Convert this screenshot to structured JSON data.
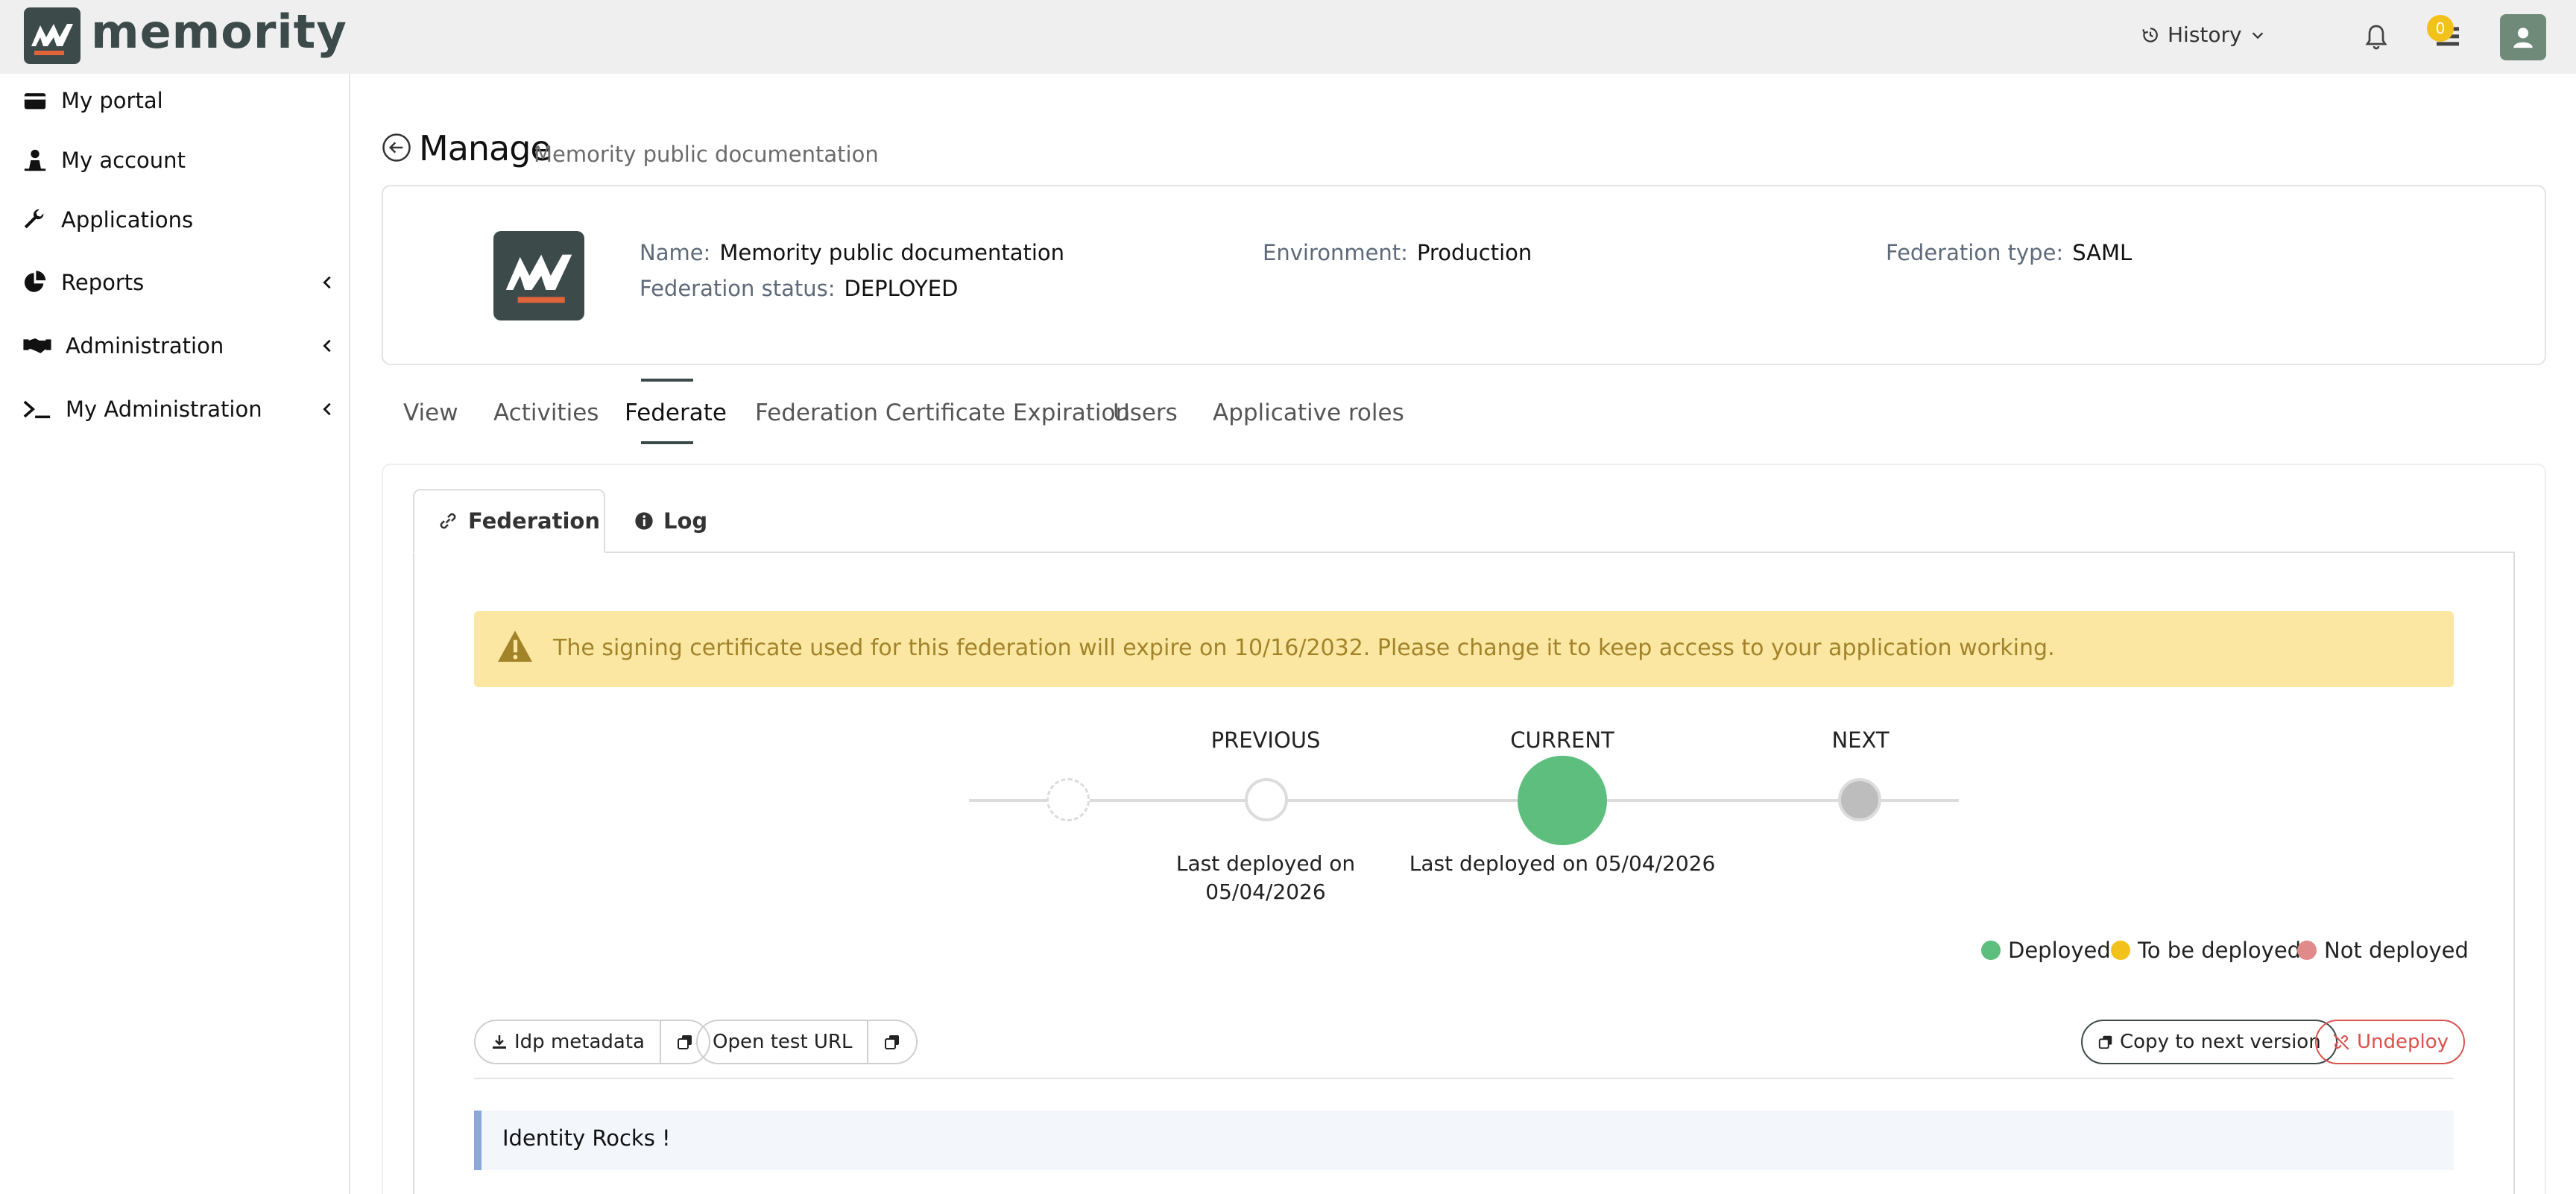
{
  "app": {
    "logo_text": "memority"
  },
  "header": {
    "history_label": "History",
    "tasks_badge": "0"
  },
  "sidebar": {
    "items": [
      {
        "label": "My portal",
        "icon": "wallet-icon"
      },
      {
        "label": "My account",
        "icon": "user-icon"
      },
      {
        "label": "Applications",
        "icon": "wrench-icon"
      },
      {
        "label": "Reports",
        "icon": "pie-chart-icon"
      },
      {
        "label": "Administration",
        "icon": "handshake-icon"
      },
      {
        "label": "My Administration",
        "icon": "terminal-icon"
      }
    ]
  },
  "page": {
    "title": "Manage",
    "subtitle": "Memority public documentation"
  },
  "info": {
    "name_key": "Name:",
    "name_val": "Memority public documentation",
    "status_key": "Federation status:",
    "status_val": "DEPLOYED",
    "env_key": "Environment:",
    "env_val": "Production",
    "type_key": "Federation type:",
    "type_val": "SAML"
  },
  "tabs": [
    "View",
    "Activities",
    "Federate",
    "Federation Certificate Expiration",
    "Users",
    "Applicative roles"
  ],
  "subtabs": {
    "federation": "Federation",
    "log": "Log"
  },
  "alert": {
    "text": "The signing certificate used for this federation will expire on 10/16/2032. Please change it to keep access to your application working."
  },
  "timeline": {
    "previous_label": "PREVIOUS",
    "current_label": "CURRENT",
    "next_label": "NEXT",
    "previous_caption_1": "Last deployed on",
    "previous_caption_2": "05/04/2026",
    "current_caption": "Last deployed on 05/04/2026"
  },
  "legend": {
    "deployed": "Deployed",
    "to_be_deployed": "To be deployed",
    "not_deployed": "Not deployed",
    "colors": {
      "deployed": "#5dbe7e",
      "to_be_deployed": "#f3c21a",
      "not_deployed": "#e08a8a"
    }
  },
  "actions": {
    "idp_metadata": "Idp metadata",
    "open_test_url": "Open test URL",
    "copy_next": "Copy to next version",
    "undeploy": "Undeploy"
  },
  "note": {
    "text": "Identity Rocks !"
  }
}
